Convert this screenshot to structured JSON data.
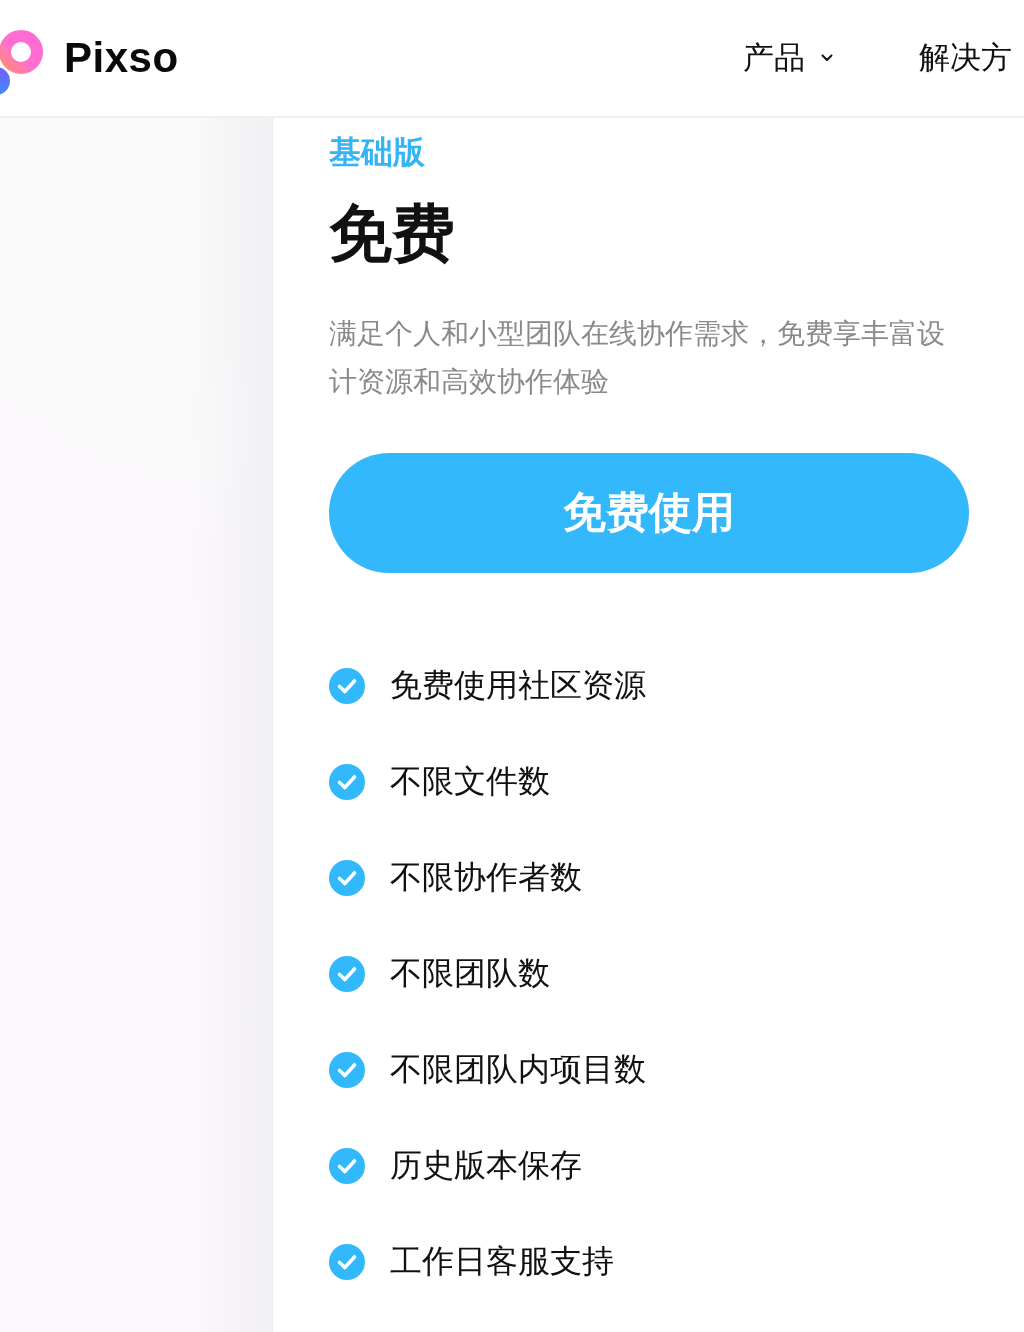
{
  "header": {
    "brand": "Pixso",
    "nav": [
      {
        "label": "产品",
        "dropdown": true
      },
      {
        "label": "解决方",
        "dropdown": false
      }
    ]
  },
  "plan": {
    "tier": "基础版",
    "price": "免费",
    "description": "满足个人和小型团队在线协作需求，免费享丰富设计资源和高效协作体验",
    "cta": "免费使用",
    "features": [
      "免费使用社区资源",
      "不限文件数",
      "不限协作者数",
      "不限团队数",
      "不限团队内项目数",
      "历史版本保存",
      "工作日客服支持"
    ]
  }
}
